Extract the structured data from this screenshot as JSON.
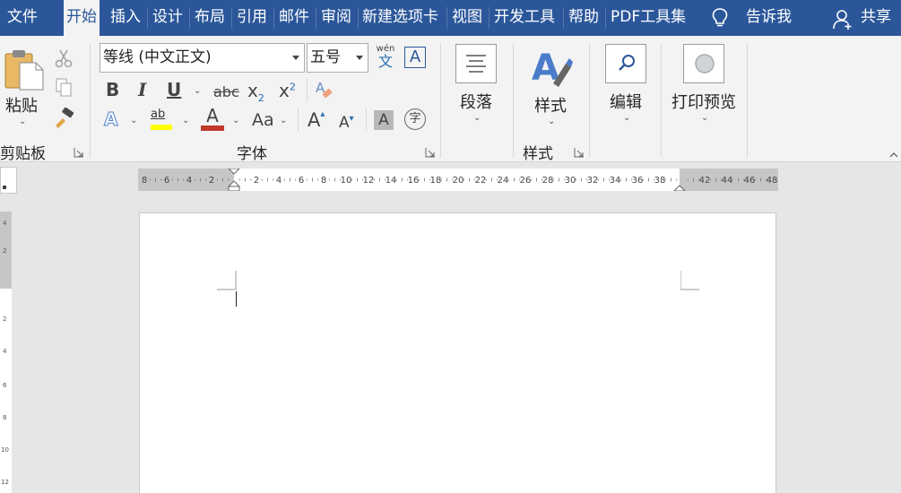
{
  "tabs": [
    {
      "label": "文件"
    },
    {
      "label": "开始"
    },
    {
      "label": "插入"
    },
    {
      "label": "设计"
    },
    {
      "label": "布局"
    },
    {
      "label": "引用"
    },
    {
      "label": "邮件"
    },
    {
      "label": "审阅"
    },
    {
      "label": "新建选项卡"
    },
    {
      "label": "视图"
    },
    {
      "label": "开发工具"
    },
    {
      "label": "帮助"
    },
    {
      "label": "PDF工具集"
    }
  ],
  "tell_me": "告诉我",
  "share": "共享",
  "clipboard": {
    "paste": "粘贴",
    "group": "剪贴板"
  },
  "font": {
    "name": "等线 (中文正文)",
    "size": "五号",
    "group": "字体",
    "wen_pinyin": "wén",
    "wen_char": "文",
    "bold": "B",
    "italic": "I",
    "underline": "U",
    "strike": "abc",
    "sub_base": "x",
    "sub_mark": "2",
    "sup_base": "x",
    "sup_mark": "2",
    "text_effect": "A",
    "highlight": "ab",
    "font_color": "A",
    "change_case": "Aa",
    "grow": "A",
    "shrink": "A",
    "shading": "A",
    "enclose": "字",
    "border_char": "A"
  },
  "paragraph": {
    "label": "段落"
  },
  "styles": {
    "label": "样式",
    "group": "样式"
  },
  "editing": {
    "label": "编辑"
  },
  "print_preview": {
    "label": "打印预览"
  },
  "ruler": {
    "left_numbers": [
      "8",
      "6",
      "4",
      "2"
    ],
    "right_numbers": [
      "2",
      "4",
      "6",
      "8",
      "10",
      "12",
      "14",
      "16",
      "18",
      "20",
      "22",
      "24",
      "26",
      "28",
      "30",
      "32",
      "34",
      "36",
      "38"
    ],
    "far_numbers": [
      "42",
      "44",
      "46",
      "48"
    ]
  },
  "colors": {
    "accent": "#2b579a",
    "highlight": "#ffff00",
    "font_color": "#c0392b"
  }
}
